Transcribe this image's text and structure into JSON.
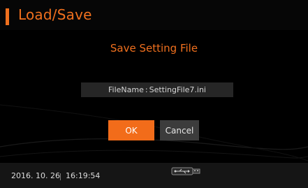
{
  "header": {
    "title": "Load/Save"
  },
  "dialog": {
    "title": "Save Setting File",
    "filename_label": "FileName",
    "filename_separator": ":",
    "filename_value": "SettingFile7.ini",
    "ok_label": "OK",
    "cancel_label": "Cancel"
  },
  "status": {
    "date": "2016. 10. 26",
    "time": "16:19:54",
    "storage_icon": "usb-drive-icon"
  },
  "colors": {
    "accent": "#f0701e",
    "ok_button": "#f26c1a",
    "cancel_button": "#3c3c3c",
    "background": "#000000"
  }
}
